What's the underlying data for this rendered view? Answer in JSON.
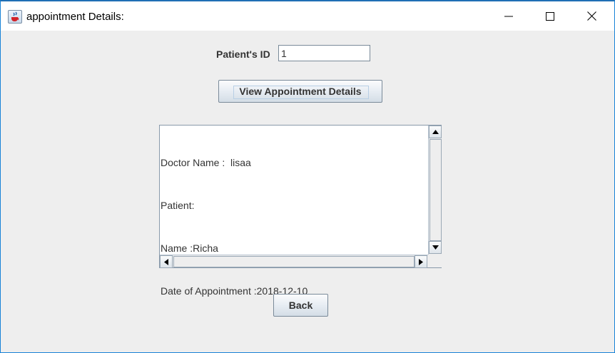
{
  "window": {
    "title": "appointment Details:"
  },
  "form": {
    "patient_id_label": "Patient's ID",
    "patient_id_value": "1",
    "view_button_label": "View Appointment Details",
    "back_button_label": "Back"
  },
  "details": {
    "lines": [
      "Doctor Name :  lisaa",
      "Patient:",
      "Name :Richa",
      "Date of Appointment :2018-12-10"
    ]
  },
  "icons": {
    "app": "java-cup-icon",
    "minimize": "minimize-icon",
    "maximize": "maximize-icon",
    "close": "close-icon"
  }
}
